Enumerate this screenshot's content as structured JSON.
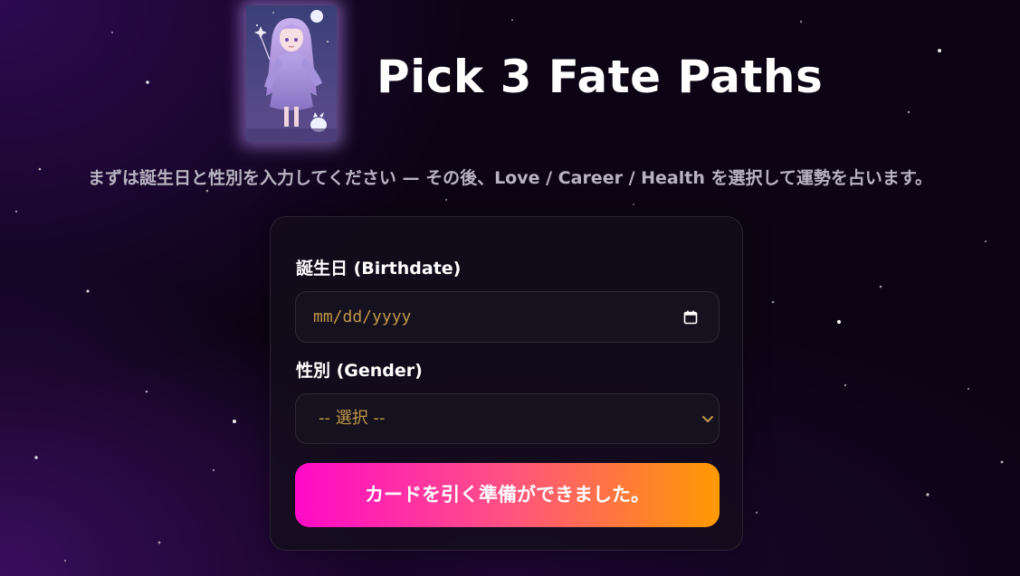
{
  "header": {
    "title": "Pick 3 Fate Paths",
    "subtitle": "まずは誕生日と性別を入力してください — その後、Love / Career / Health を選択して運勢を占います。",
    "hero_icon": "anime-witch-card-image"
  },
  "form": {
    "birthdate": {
      "label": "誕生日 (Birthdate)",
      "placeholder": "mm/dd/yyyy",
      "icon": "calendar-icon"
    },
    "gender": {
      "label": "性別 (Gender)",
      "selected": "-- 選択 --",
      "icon": "chevron-down-icon"
    },
    "submit_label": "カードを引く準備ができました。"
  },
  "colors": {
    "background": "#0c0414",
    "card_bg": "#140e1c",
    "placeholder_text": "#c09848",
    "button_gradient_start": "#ff0ac8",
    "button_gradient_mid": "#ff4f86",
    "button_gradient_end": "#ff9a00",
    "subtitle_text": "#b8b3c2"
  }
}
